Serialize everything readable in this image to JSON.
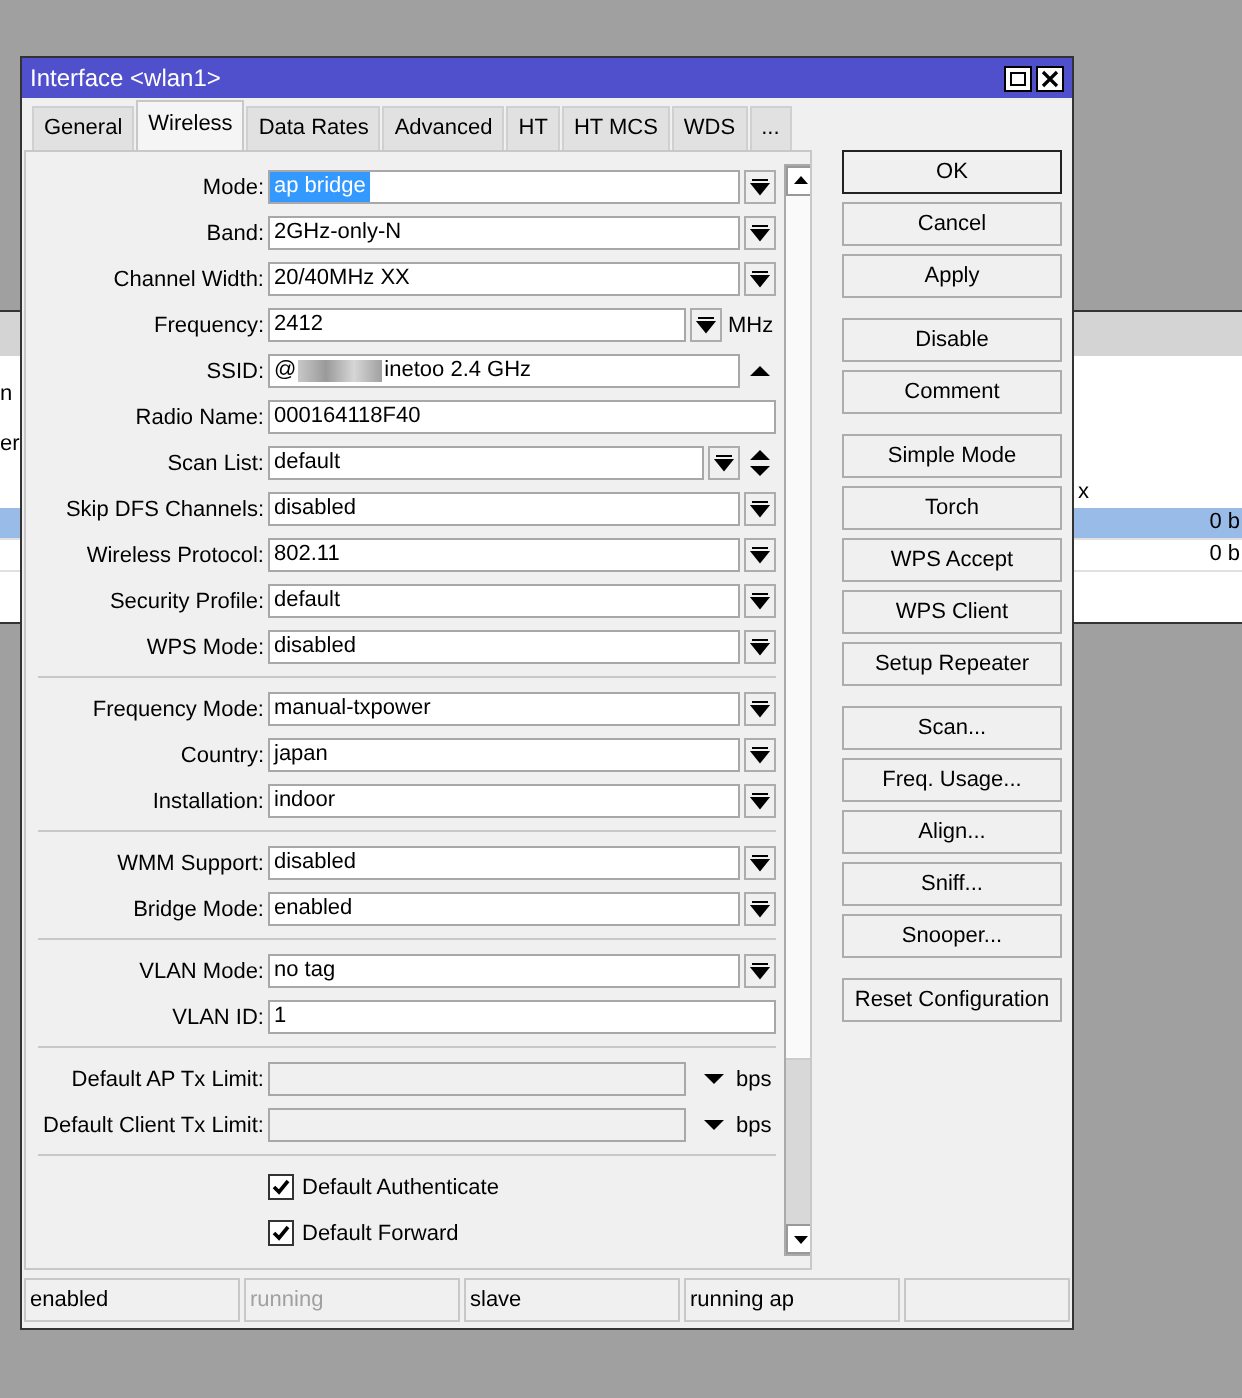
{
  "background_window": {
    "left_texts": [
      "n",
      "er"
    ],
    "column_header": "x",
    "rows": [
      {
        "value": "0 b",
        "selected": true
      },
      {
        "value": "0 b",
        "selected": false
      }
    ]
  },
  "window": {
    "title": "Interface <wlan1>"
  },
  "tabs": [
    {
      "label": "General",
      "selected": false
    },
    {
      "label": "Wireless",
      "selected": true
    },
    {
      "label": "Data Rates",
      "selected": false
    },
    {
      "label": "Advanced",
      "selected": false
    },
    {
      "label": "HT",
      "selected": false
    },
    {
      "label": "HT MCS",
      "selected": false
    },
    {
      "label": "WDS",
      "selected": false
    },
    {
      "label": "...",
      "selected": false
    }
  ],
  "form": {
    "groups": [
      {
        "rows": [
          {
            "label": "Mode:",
            "kind": "select",
            "value": "ap bridge",
            "highlighted": true
          },
          {
            "label": "Band:",
            "kind": "select",
            "value": "2GHz-only-N",
            "highlighted": false
          },
          {
            "label": "Channel Width:",
            "kind": "select",
            "value": "20/40MHz XX",
            "highlighted": false
          },
          {
            "label": "Frequency:",
            "kind": "select_unit",
            "value": "2412",
            "unit": "MHz",
            "highlighted": false
          },
          {
            "label": "SSID:",
            "kind": "ssid",
            "value": "@",
            "value_end": "inetoo 2.4 GHz",
            "highlighted": false
          },
          {
            "label": "Radio Name:",
            "kind": "text",
            "value": "000164118F40",
            "highlighted": false
          },
          {
            "label": "Scan List:",
            "kind": "scan_list",
            "value": "default",
            "highlighted": false
          },
          {
            "label": "Skip DFS Channels:",
            "kind": "select",
            "value": "disabled",
            "highlighted": false
          },
          {
            "label": "Wireless Protocol:",
            "kind": "select",
            "value": "802.11",
            "highlighted": false
          },
          {
            "label": "Security Profile:",
            "kind": "select",
            "value": "default",
            "highlighted": false
          },
          {
            "label": "WPS Mode:",
            "kind": "select",
            "value": "disabled",
            "highlighted": false
          }
        ]
      },
      {
        "rows": [
          {
            "label": "Frequency Mode:",
            "kind": "select",
            "value": "manual-txpower",
            "highlighted": false
          },
          {
            "label": "Country:",
            "kind": "select",
            "value": "japan",
            "highlighted": false
          },
          {
            "label": "Installation:",
            "kind": "select",
            "value": "indoor",
            "highlighted": false
          }
        ]
      },
      {
        "rows": [
          {
            "label": "WMM Support:",
            "kind": "select",
            "value": "disabled",
            "highlighted": false
          },
          {
            "label": "Bridge Mode:",
            "kind": "select",
            "value": "enabled",
            "highlighted": false
          }
        ]
      },
      {
        "rows": [
          {
            "label": "VLAN Mode:",
            "kind": "select",
            "value": "no tag",
            "highlighted": false
          },
          {
            "label": "VLAN ID:",
            "kind": "text",
            "value": "1",
            "highlighted": false
          }
        ]
      },
      {
        "rows": [
          {
            "label": "Default AP Tx Limit:",
            "kind": "limit",
            "unit": "bps"
          },
          {
            "label": "Default Client Tx Limit:",
            "kind": "limit",
            "unit": "bps"
          }
        ]
      }
    ],
    "checkboxes": [
      {
        "label": "Default Authenticate",
        "checked": true
      },
      {
        "label": "Default Forward",
        "checked": true
      }
    ]
  },
  "buttons": [
    [
      {
        "label": "OK",
        "default": true
      },
      {
        "label": "Cancel",
        "default": false
      },
      {
        "label": "Apply",
        "default": false
      }
    ],
    [
      {
        "label": "Disable",
        "default": false
      },
      {
        "label": "Comment",
        "default": false
      }
    ],
    [
      {
        "label": "Simple Mode",
        "default": false
      },
      {
        "label": "Torch",
        "default": false
      },
      {
        "label": "WPS Accept",
        "default": false
      },
      {
        "label": "WPS Client",
        "default": false
      },
      {
        "label": "Setup Repeater",
        "default": false
      }
    ],
    [
      {
        "label": "Scan...",
        "default": false
      },
      {
        "label": "Freq. Usage...",
        "default": false
      },
      {
        "label": "Align...",
        "default": false
      },
      {
        "label": "Sniff...",
        "default": false
      },
      {
        "label": "Snooper...",
        "default": false
      }
    ],
    [
      {
        "label": "Reset Configuration",
        "default": false
      }
    ]
  ],
  "status_bar": [
    {
      "text": "enabled",
      "disabled": false
    },
    {
      "text": "running",
      "disabled": true
    },
    {
      "text": "slave",
      "disabled": false
    },
    {
      "text": "running ap",
      "disabled": false
    }
  ]
}
